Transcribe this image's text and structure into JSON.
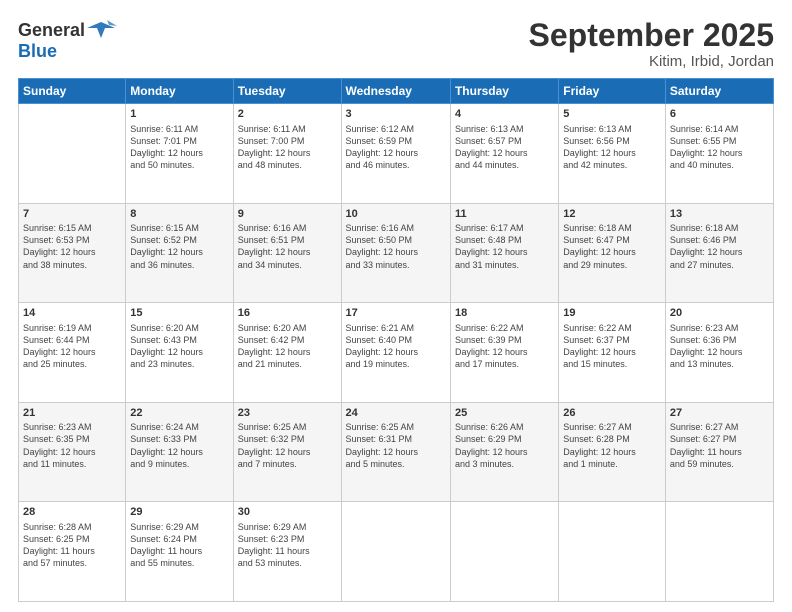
{
  "header": {
    "logo_line1": "General",
    "logo_line2": "Blue",
    "title": "September 2025",
    "subtitle": "Kitim, Irbid, Jordan"
  },
  "weekdays": [
    "Sunday",
    "Monday",
    "Tuesday",
    "Wednesday",
    "Thursday",
    "Friday",
    "Saturday"
  ],
  "weeks": [
    [
      {
        "day": "",
        "info": ""
      },
      {
        "day": "1",
        "info": "Sunrise: 6:11 AM\nSunset: 7:01 PM\nDaylight: 12 hours\nand 50 minutes."
      },
      {
        "day": "2",
        "info": "Sunrise: 6:11 AM\nSunset: 7:00 PM\nDaylight: 12 hours\nand 48 minutes."
      },
      {
        "day": "3",
        "info": "Sunrise: 6:12 AM\nSunset: 6:59 PM\nDaylight: 12 hours\nand 46 minutes."
      },
      {
        "day": "4",
        "info": "Sunrise: 6:13 AM\nSunset: 6:57 PM\nDaylight: 12 hours\nand 44 minutes."
      },
      {
        "day": "5",
        "info": "Sunrise: 6:13 AM\nSunset: 6:56 PM\nDaylight: 12 hours\nand 42 minutes."
      },
      {
        "day": "6",
        "info": "Sunrise: 6:14 AM\nSunset: 6:55 PM\nDaylight: 12 hours\nand 40 minutes."
      }
    ],
    [
      {
        "day": "7",
        "info": "Sunrise: 6:15 AM\nSunset: 6:53 PM\nDaylight: 12 hours\nand 38 minutes."
      },
      {
        "day": "8",
        "info": "Sunrise: 6:15 AM\nSunset: 6:52 PM\nDaylight: 12 hours\nand 36 minutes."
      },
      {
        "day": "9",
        "info": "Sunrise: 6:16 AM\nSunset: 6:51 PM\nDaylight: 12 hours\nand 34 minutes."
      },
      {
        "day": "10",
        "info": "Sunrise: 6:16 AM\nSunset: 6:50 PM\nDaylight: 12 hours\nand 33 minutes."
      },
      {
        "day": "11",
        "info": "Sunrise: 6:17 AM\nSunset: 6:48 PM\nDaylight: 12 hours\nand 31 minutes."
      },
      {
        "day": "12",
        "info": "Sunrise: 6:18 AM\nSunset: 6:47 PM\nDaylight: 12 hours\nand 29 minutes."
      },
      {
        "day": "13",
        "info": "Sunrise: 6:18 AM\nSunset: 6:46 PM\nDaylight: 12 hours\nand 27 minutes."
      }
    ],
    [
      {
        "day": "14",
        "info": "Sunrise: 6:19 AM\nSunset: 6:44 PM\nDaylight: 12 hours\nand 25 minutes."
      },
      {
        "day": "15",
        "info": "Sunrise: 6:20 AM\nSunset: 6:43 PM\nDaylight: 12 hours\nand 23 minutes."
      },
      {
        "day": "16",
        "info": "Sunrise: 6:20 AM\nSunset: 6:42 PM\nDaylight: 12 hours\nand 21 minutes."
      },
      {
        "day": "17",
        "info": "Sunrise: 6:21 AM\nSunset: 6:40 PM\nDaylight: 12 hours\nand 19 minutes."
      },
      {
        "day": "18",
        "info": "Sunrise: 6:22 AM\nSunset: 6:39 PM\nDaylight: 12 hours\nand 17 minutes."
      },
      {
        "day": "19",
        "info": "Sunrise: 6:22 AM\nSunset: 6:37 PM\nDaylight: 12 hours\nand 15 minutes."
      },
      {
        "day": "20",
        "info": "Sunrise: 6:23 AM\nSunset: 6:36 PM\nDaylight: 12 hours\nand 13 minutes."
      }
    ],
    [
      {
        "day": "21",
        "info": "Sunrise: 6:23 AM\nSunset: 6:35 PM\nDaylight: 12 hours\nand 11 minutes."
      },
      {
        "day": "22",
        "info": "Sunrise: 6:24 AM\nSunset: 6:33 PM\nDaylight: 12 hours\nand 9 minutes."
      },
      {
        "day": "23",
        "info": "Sunrise: 6:25 AM\nSunset: 6:32 PM\nDaylight: 12 hours\nand 7 minutes."
      },
      {
        "day": "24",
        "info": "Sunrise: 6:25 AM\nSunset: 6:31 PM\nDaylight: 12 hours\nand 5 minutes."
      },
      {
        "day": "25",
        "info": "Sunrise: 6:26 AM\nSunset: 6:29 PM\nDaylight: 12 hours\nand 3 minutes."
      },
      {
        "day": "26",
        "info": "Sunrise: 6:27 AM\nSunset: 6:28 PM\nDaylight: 12 hours\nand 1 minute."
      },
      {
        "day": "27",
        "info": "Sunrise: 6:27 AM\nSunset: 6:27 PM\nDaylight: 11 hours\nand 59 minutes."
      }
    ],
    [
      {
        "day": "28",
        "info": "Sunrise: 6:28 AM\nSunset: 6:25 PM\nDaylight: 11 hours\nand 57 minutes."
      },
      {
        "day": "29",
        "info": "Sunrise: 6:29 AM\nSunset: 6:24 PM\nDaylight: 11 hours\nand 55 minutes."
      },
      {
        "day": "30",
        "info": "Sunrise: 6:29 AM\nSunset: 6:23 PM\nDaylight: 11 hours\nand 53 minutes."
      },
      {
        "day": "",
        "info": ""
      },
      {
        "day": "",
        "info": ""
      },
      {
        "day": "",
        "info": ""
      },
      {
        "day": "",
        "info": ""
      }
    ]
  ]
}
